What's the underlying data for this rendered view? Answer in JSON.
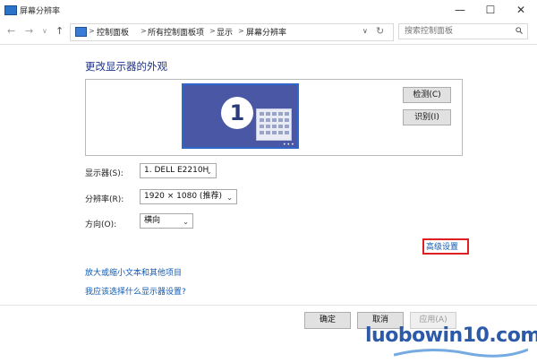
{
  "window": {
    "title": "屏幕分辨率",
    "minimize_glyph": "—",
    "maximize_glyph": "☐",
    "close_glyph": "✕"
  },
  "nav": {
    "back_glyph": "←",
    "forward_glyph": "→",
    "recent_glyph": "∨",
    "up_glyph": "↑",
    "breadcrumbs": [
      "控制面板",
      "所有控制面板项",
      "显示",
      "屏幕分辨率"
    ],
    "separator": ">",
    "search_placeholder": "搜索控制面板"
  },
  "content": {
    "title": "更改显示器的外观",
    "monitor_number": "1",
    "monitor_dots": "•••",
    "detect_label": "检测(C)",
    "identify_label": "识别(I)",
    "display_label": "显示器(S):",
    "display_value": "1. DELL E2210H",
    "resolution_label": "分辨率(R):",
    "resolution_value": "1920 × 1080 (推荐)",
    "orientation_label": "方向(O):",
    "orientation_value": "横向",
    "advanced_link": "高级设置",
    "link_text_size": "放大或缩小文本和其他项目",
    "link_which_settings": "我应该选择什么显示器设置?"
  },
  "footer": {
    "ok_label": "确定",
    "cancel_label": "取消",
    "apply_label": "应用(A)"
  },
  "watermark": {
    "text": "luobowin10.com"
  },
  "colors": {
    "accent_blue": "#0f5ab3",
    "title_blue": "#1e3287",
    "monitor_fill": "#4a57a5",
    "highlight_red": "#e02020"
  }
}
